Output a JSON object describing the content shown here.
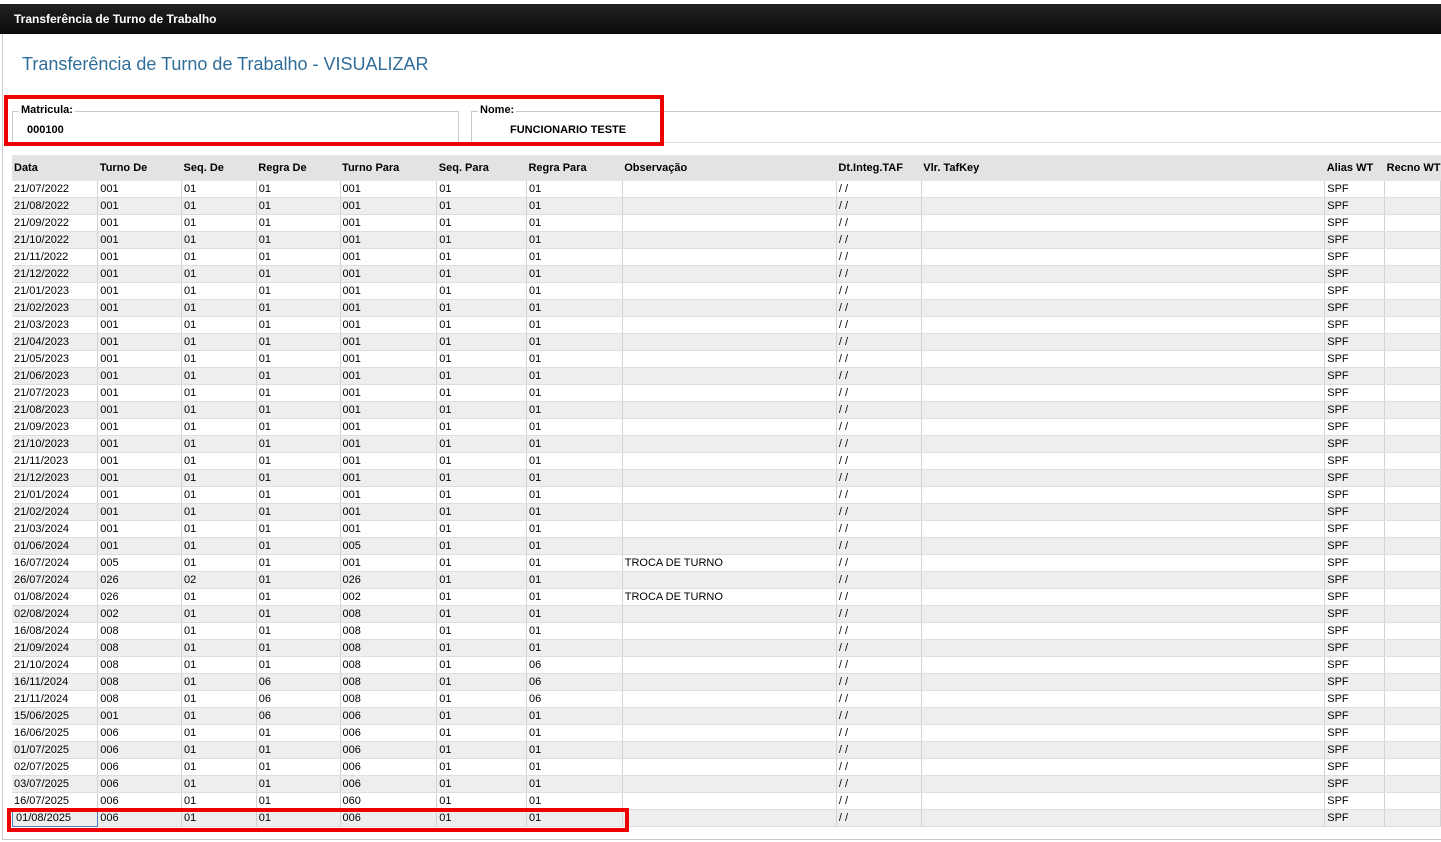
{
  "window": {
    "title": "Transferência de Turno de Trabalho"
  },
  "page": {
    "title": "Transferência de Turno de Trabalho - VISUALIZAR"
  },
  "fields": {
    "matricula": {
      "label": "Matricula:",
      "value": "000100"
    },
    "nome": {
      "label": "Nome:",
      "value": "FUNCIONARIO TESTE"
    }
  },
  "table": {
    "columns": [
      "Data",
      "Turno De",
      "Seq. De",
      "Regra De",
      "Turno Para",
      "Seq. Para",
      "Regra Para",
      "Observação",
      "Dt.Integ.TAF",
      "Vlr. TafKey",
      "Alias WT",
      "Recno WT"
    ],
    "rows": [
      [
        "21/07/2022",
        "001",
        "01",
        "01",
        "001",
        "01",
        "01",
        "",
        "/ /",
        "",
        "SPF",
        ""
      ],
      [
        "21/08/2022",
        "001",
        "01",
        "01",
        "001",
        "01",
        "01",
        "",
        "/ /",
        "",
        "SPF",
        ""
      ],
      [
        "21/09/2022",
        "001",
        "01",
        "01",
        "001",
        "01",
        "01",
        "",
        "/ /",
        "",
        "SPF",
        ""
      ],
      [
        "21/10/2022",
        "001",
        "01",
        "01",
        "001",
        "01",
        "01",
        "",
        "/ /",
        "",
        "SPF",
        ""
      ],
      [
        "21/11/2022",
        "001",
        "01",
        "01",
        "001",
        "01",
        "01",
        "",
        "/ /",
        "",
        "SPF",
        ""
      ],
      [
        "21/12/2022",
        "001",
        "01",
        "01",
        "001",
        "01",
        "01",
        "",
        "/ /",
        "",
        "SPF",
        ""
      ],
      [
        "21/01/2023",
        "001",
        "01",
        "01",
        "001",
        "01",
        "01",
        "",
        "/ /",
        "",
        "SPF",
        ""
      ],
      [
        "21/02/2023",
        "001",
        "01",
        "01",
        "001",
        "01",
        "01",
        "",
        "/ /",
        "",
        "SPF",
        ""
      ],
      [
        "21/03/2023",
        "001",
        "01",
        "01",
        "001",
        "01",
        "01",
        "",
        "/ /",
        "",
        "SPF",
        ""
      ],
      [
        "21/04/2023",
        "001",
        "01",
        "01",
        "001",
        "01",
        "01",
        "",
        "/ /",
        "",
        "SPF",
        ""
      ],
      [
        "21/05/2023",
        "001",
        "01",
        "01",
        "001",
        "01",
        "01",
        "",
        "/ /",
        "",
        "SPF",
        ""
      ],
      [
        "21/06/2023",
        "001",
        "01",
        "01",
        "001",
        "01",
        "01",
        "",
        "/ /",
        "",
        "SPF",
        ""
      ],
      [
        "21/07/2023",
        "001",
        "01",
        "01",
        "001",
        "01",
        "01",
        "",
        "/ /",
        "",
        "SPF",
        ""
      ],
      [
        "21/08/2023",
        "001",
        "01",
        "01",
        "001",
        "01",
        "01",
        "",
        "/ /",
        "",
        "SPF",
        ""
      ],
      [
        "21/09/2023",
        "001",
        "01",
        "01",
        "001",
        "01",
        "01",
        "",
        "/ /",
        "",
        "SPF",
        ""
      ],
      [
        "21/10/2023",
        "001",
        "01",
        "01",
        "001",
        "01",
        "01",
        "",
        "/ /",
        "",
        "SPF",
        ""
      ],
      [
        "21/11/2023",
        "001",
        "01",
        "01",
        "001",
        "01",
        "01",
        "",
        "/ /",
        "",
        "SPF",
        ""
      ],
      [
        "21/12/2023",
        "001",
        "01",
        "01",
        "001",
        "01",
        "01",
        "",
        "/ /",
        "",
        "SPF",
        ""
      ],
      [
        "21/01/2024",
        "001",
        "01",
        "01",
        "001",
        "01",
        "01",
        "",
        "/ /",
        "",
        "SPF",
        ""
      ],
      [
        "21/02/2024",
        "001",
        "01",
        "01",
        "001",
        "01",
        "01",
        "",
        "/ /",
        "",
        "SPF",
        ""
      ],
      [
        "21/03/2024",
        "001",
        "01",
        "01",
        "001",
        "01",
        "01",
        "",
        "/ /",
        "",
        "SPF",
        ""
      ],
      [
        "01/06/2024",
        "001",
        "01",
        "01",
        "005",
        "01",
        "01",
        "",
        "/ /",
        "",
        "SPF",
        ""
      ],
      [
        "16/07/2024",
        "005",
        "01",
        "01",
        "001",
        "01",
        "01",
        "TROCA DE TURNO",
        "/ /",
        "",
        "SPF",
        ""
      ],
      [
        "26/07/2024",
        "026",
        "02",
        "01",
        "026",
        "01",
        "01",
        "",
        "/ /",
        "",
        "SPF",
        ""
      ],
      [
        "01/08/2024",
        "026",
        "01",
        "01",
        "002",
        "01",
        "01",
        "TROCA DE TURNO",
        "/ /",
        "",
        "SPF",
        ""
      ],
      [
        "02/08/2024",
        "002",
        "01",
        "01",
        "008",
        "01",
        "01",
        "",
        "/ /",
        "",
        "SPF",
        ""
      ],
      [
        "16/08/2024",
        "008",
        "01",
        "01",
        "008",
        "01",
        "01",
        "",
        "/ /",
        "",
        "SPF",
        ""
      ],
      [
        "21/09/2024",
        "008",
        "01",
        "01",
        "008",
        "01",
        "01",
        "",
        "/ /",
        "",
        "SPF",
        ""
      ],
      [
        "21/10/2024",
        "008",
        "01",
        "01",
        "008",
        "01",
        "06",
        "",
        "/ /",
        "",
        "SPF",
        ""
      ],
      [
        "16/11/2024",
        "008",
        "01",
        "06",
        "008",
        "01",
        "06",
        "",
        "/ /",
        "",
        "SPF",
        ""
      ],
      [
        "21/11/2024",
        "008",
        "01",
        "06",
        "008",
        "01",
        "06",
        "",
        "/ /",
        "",
        "SPF",
        ""
      ],
      [
        "15/06/2025",
        "001",
        "01",
        "06",
        "006",
        "01",
        "01",
        "",
        "/ /",
        "",
        "SPF",
        ""
      ],
      [
        "16/06/2025",
        "006",
        "01",
        "01",
        "006",
        "01",
        "01",
        "",
        "/ /",
        "",
        "SPF",
        ""
      ],
      [
        "01/07/2025",
        "006",
        "01",
        "01",
        "006",
        "01",
        "01",
        "",
        "/ /",
        "",
        "SPF",
        ""
      ],
      [
        "02/07/2025",
        "006",
        "01",
        "01",
        "006",
        "01",
        "01",
        "",
        "/ /",
        "",
        "SPF",
        ""
      ],
      [
        "03/07/2025",
        "006",
        "01",
        "01",
        "006",
        "01",
        "01",
        "",
        "/ /",
        "",
        "SPF",
        ""
      ],
      [
        "16/07/2025",
        "006",
        "01",
        "01",
        "060",
        "01",
        "01",
        "",
        "/ /",
        "",
        "SPF",
        ""
      ],
      [
        "01/08/2025",
        "006",
        "01",
        "01",
        "006",
        "01",
        "01",
        "",
        "/ /",
        "",
        "SPF",
        ""
      ]
    ]
  },
  "colors": {
    "title": "#2f6e9a",
    "highlight": "#ee0000",
    "titlebar": "#111111"
  }
}
